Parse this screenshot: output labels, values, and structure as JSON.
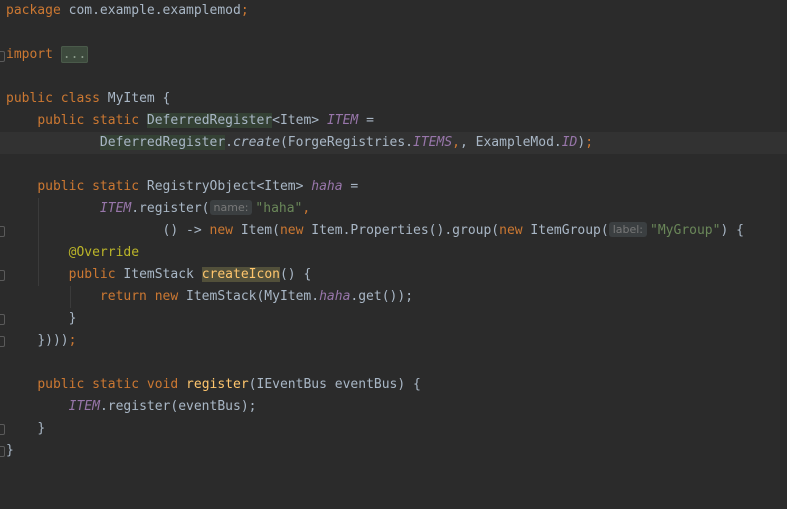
{
  "code": {
    "package_kw": "package",
    "package_name": "com.example.examplemod",
    "semicolon": ";",
    "import_kw": "import",
    "import_fold": "...",
    "public": "public",
    "static": "static",
    "class": "class",
    "void": "void",
    "new": "new",
    "return": "return",
    "class_name": "MyItem",
    "open_brace": " {",
    "deferred_register": "DeferredRegister",
    "item_generic": "<Item>",
    "item_field": "ITEM",
    "assign": " =",
    "create_method": "create",
    "forge_registries": "(ForgeRegistries.",
    "items_const": "ITEMS",
    "example_mod": ", ExampleMod.",
    "id_const": "ID",
    "close_paren_semi": ");",
    "registry_object": "RegistryObject<Item>",
    "haha_field": "haha",
    "register_call": ".register(",
    "hint_name": "name:",
    "haha_string": "\"haha\"",
    "comma": ",",
    "lambda_start": "() -> ",
    "item_ctor": " Item(",
    "item_properties": " Item.Properties().group(",
    "item_group": " ItemGroup(",
    "hint_label": "label:",
    "mygroup_string": "\"MyGroup\"",
    "close_paren_brace": ") {",
    "override_annotation": "@Override",
    "item_stack_type": "ItemStack ",
    "create_icon_method": "createIcon",
    "paren_brace": "() {",
    "item_stack_ctor": " ItemStack(MyItem.",
    "get_call": ".get());",
    "close_brace": "}",
    "close_chain": "}))",
    "register_method": "register",
    "register_params": "(IEventBus eventBus) {",
    "register_event_bus": ".register(eventBus);"
  }
}
